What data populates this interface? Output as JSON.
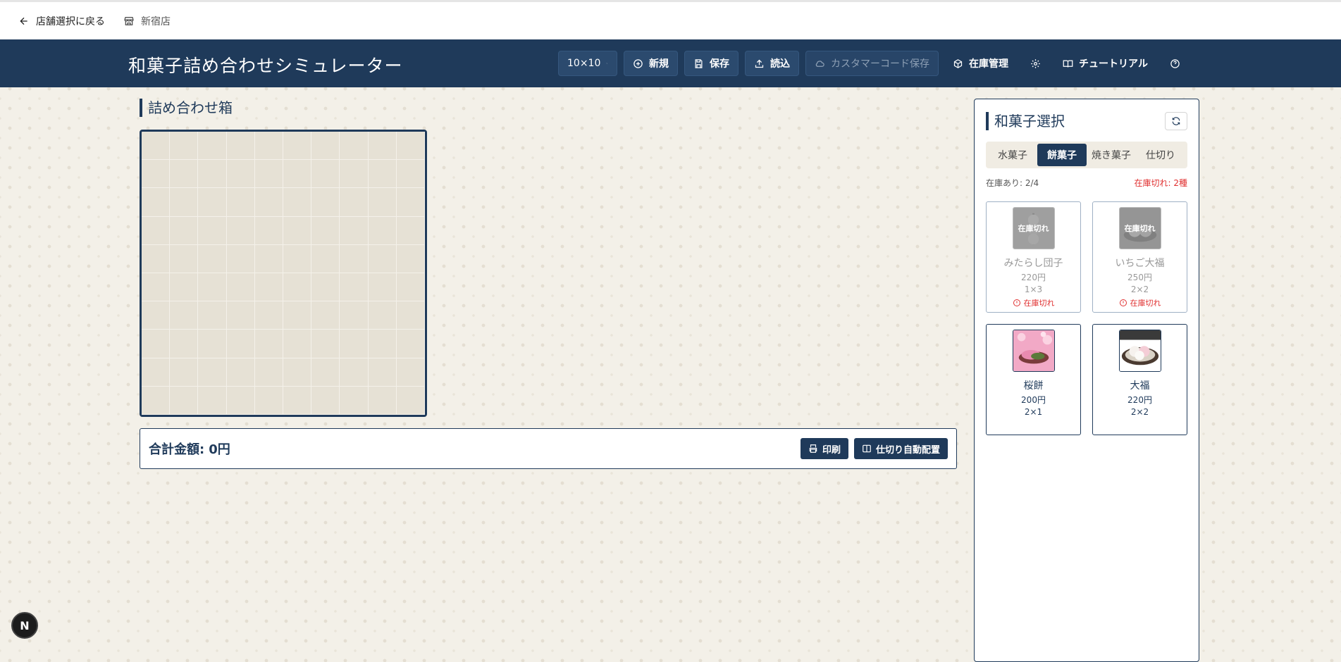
{
  "subbar": {
    "back_label": "店舗選択に戻る",
    "store_name": "新宿店"
  },
  "header": {
    "title": "和菓子詰め合わせシミュレーター",
    "size_select": "10×10",
    "new_label": "新規",
    "save_label": "保存",
    "load_label": "読込",
    "customer_save_label": "カスタマーコード保存",
    "inventory_label": "在庫管理",
    "tutorial_label": "チュートリアル"
  },
  "box": {
    "title": "詰め合わせ箱",
    "cols": 10,
    "rows": 10
  },
  "total": {
    "label": "合計金額:",
    "value": "0円",
    "print_label": "印刷",
    "auto_partition_label": "仕切り自動配置"
  },
  "panel": {
    "title": "和菓子選択",
    "tabs": [
      "水菓子",
      "餅菓子",
      "焼き菓子",
      "仕切り"
    ],
    "active_tab": 1,
    "stock_available": "在庫あり: 2/4",
    "stock_out": "在庫切れ: 2種",
    "items": [
      {
        "name": "みたらし団子",
        "price": "220円",
        "size": "1×3",
        "sold_out": true,
        "overlay": "在庫切れ",
        "badge": "在庫切れ"
      },
      {
        "name": "いちご大福",
        "price": "250円",
        "size": "2×2",
        "sold_out": true,
        "overlay": "在庫切れ",
        "badge": "在庫切れ"
      },
      {
        "name": "桜餅",
        "price": "200円",
        "size": "2×1",
        "sold_out": false
      },
      {
        "name": "大福",
        "price": "220円",
        "size": "2×2",
        "sold_out": false
      }
    ]
  },
  "dev_badge": "N",
  "colors": {
    "navy": "#1f3a5a",
    "out_of_stock": "#e03030",
    "background": "#f3f0e8"
  }
}
